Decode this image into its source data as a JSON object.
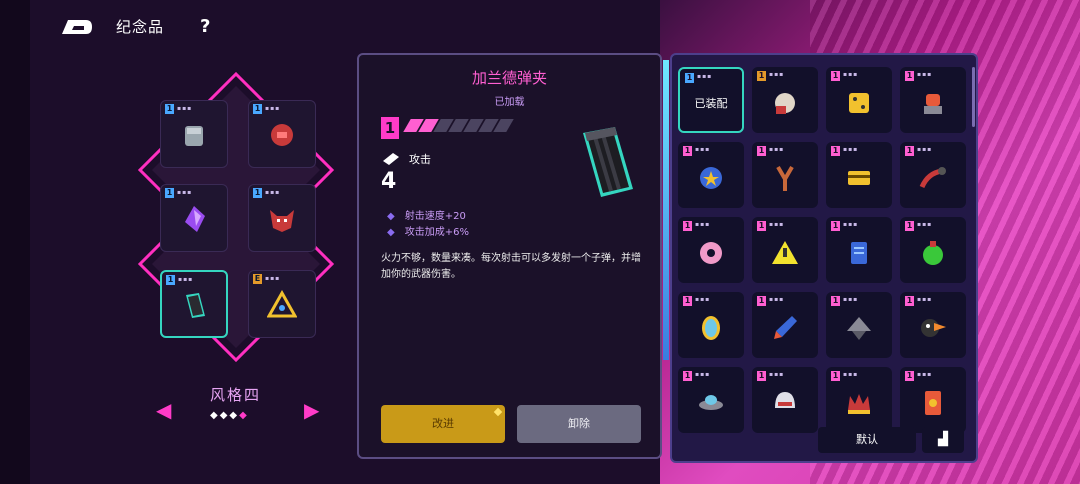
{
  "topbar": {
    "title": "纪念品",
    "help": "?"
  },
  "left": {
    "style_label": "风格四",
    "style_pages": 4,
    "style_active": 4,
    "slots": [
      {
        "level": "1",
        "icon": "gauntlet-icon"
      },
      {
        "level": "1",
        "icon": "red-token-icon"
      },
      {
        "level": "1",
        "icon": "purple-crystal-icon"
      },
      {
        "level": "1",
        "icon": "demon-mask-icon"
      },
      {
        "level": "1",
        "icon": "ammo-clip-icon",
        "selected": true
      },
      {
        "level": "E",
        "icon": "triangle-relic-icon"
      }
    ]
  },
  "detail": {
    "name": "加兰德弹夹",
    "status": "已加载",
    "rank": "1",
    "level_on": 2,
    "level_total": 7,
    "attack_label": "攻击",
    "attack_value": "4",
    "stat1": "射击速度+20",
    "stat2": "攻击加成+6%",
    "description": "火力不够，数量来凑。每次射击可以多发射一个子弹，并增加你的武器伤害。",
    "upgrade_label": "改进",
    "remove_label": "卸除"
  },
  "grid": {
    "equipped_label": "已装配",
    "default_label": "默认",
    "cells": [
      {
        "level": "1",
        "icon": "ammo-clip-icon",
        "equipped": true,
        "color": "cyan"
      },
      {
        "level": "1",
        "icon": "boxing-glove-icon",
        "color": "gold"
      },
      {
        "level": "1",
        "icon": "dice-icon"
      },
      {
        "level": "1",
        "icon": "robot-icon"
      },
      {
        "level": "1",
        "icon": "police-badge-icon"
      },
      {
        "level": "1",
        "icon": "slingshot-icon"
      },
      {
        "level": "1",
        "icon": "card-icon"
      },
      {
        "level": "1",
        "icon": "pipe-icon"
      },
      {
        "level": "1",
        "icon": "donut-icon"
      },
      {
        "level": "1",
        "icon": "warning-sign-icon"
      },
      {
        "level": "1",
        "icon": "blue-scroll-icon"
      },
      {
        "level": "1",
        "icon": "green-potion-icon"
      },
      {
        "level": "1",
        "icon": "mirror-icon"
      },
      {
        "level": "1",
        "icon": "rocket-icon"
      },
      {
        "level": "1",
        "icon": "spinning-top-icon"
      },
      {
        "level": "1",
        "icon": "toucan-icon"
      },
      {
        "level": "1",
        "icon": "ufo-icon"
      },
      {
        "level": "1",
        "icon": "helmet-icon"
      },
      {
        "level": "1",
        "icon": "crown-icon"
      },
      {
        "level": "1",
        "icon": "tarot-card-icon"
      }
    ]
  }
}
